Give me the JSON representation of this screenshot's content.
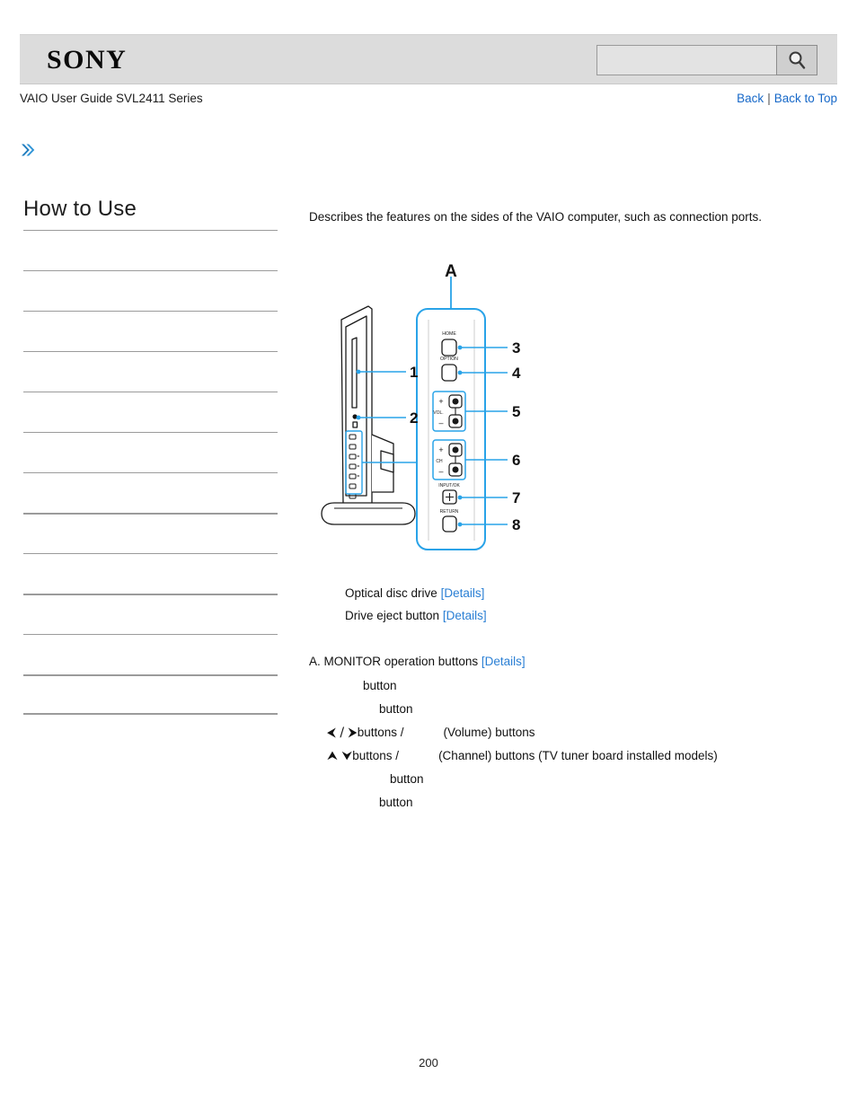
{
  "header": {
    "logo_text": "SONY",
    "search": {
      "value": "",
      "placeholder": "",
      "icon": "search-icon"
    }
  },
  "subheader": {
    "guide_title": "VAIO User Guide SVL2411 Series",
    "back_label": "Back",
    "separator": "|",
    "back_to_top_label": "Back to Top"
  },
  "breadcrumb": {
    "chevron_icon": "double-chevron-right-icon",
    "accent_color": "#2a86c8"
  },
  "sidebar": {
    "title": "How to Use",
    "items": [
      {
        "label": "",
        "thick": false
      },
      {
        "label": "",
        "thick": false
      },
      {
        "label": "",
        "thick": false
      },
      {
        "label": "",
        "thick": false
      },
      {
        "label": "",
        "thick": false
      },
      {
        "label": "",
        "thick": false
      },
      {
        "label": "",
        "thick": false
      },
      {
        "label": "",
        "thick": true
      },
      {
        "label": "",
        "thick": false
      },
      {
        "label": "",
        "thick": true
      },
      {
        "label": "",
        "thick": false
      },
      {
        "label": "",
        "thick": true
      }
    ]
  },
  "main": {
    "intro": "Describes the features on the sides of the VAIO computer, such as connection ports.",
    "figure": {
      "group_label": "A",
      "callouts": [
        "1",
        "2",
        "3",
        "4",
        "5",
        "6",
        "7",
        "8"
      ],
      "button_labels": {
        "home": "HOME",
        "option": "OPTION",
        "volume": "VOL.",
        "channel": "CH",
        "input_ok": "INPUT/OK",
        "return": "RETURN",
        "plus": "+",
        "minus": "−"
      },
      "accent_color": "#29a3e8"
    },
    "numbered_items": [
      {
        "number": "",
        "text": "Optical disc drive",
        "link": "[Details]"
      },
      {
        "number": "",
        "text": "Drive eject button",
        "link": "[Details]"
      }
    ],
    "section": {
      "heading_prefix": "A. MONITOR operation buttons",
      "heading_link": "[Details]",
      "buttons": [
        {
          "pad": 60,
          "glyph": "",
          "text": "button"
        },
        {
          "pad": 78,
          "glyph": "",
          "text": "button"
        },
        {
          "pad": 20,
          "glyph": "⮜ / ⮞",
          "text": "buttons /",
          "gap": 44,
          "suffix": "(Volume) buttons"
        },
        {
          "pad": 20,
          "glyph": "⮝  ⮟",
          "text": "buttons /",
          "gap": 44,
          "suffix": "(Channel) buttons (TV tuner board installed models)"
        },
        {
          "pad": 90,
          "glyph": "",
          "text": "button"
        },
        {
          "pad": 78,
          "glyph": "",
          "text": "button"
        }
      ]
    }
  },
  "footer": {
    "page_number": "200"
  }
}
